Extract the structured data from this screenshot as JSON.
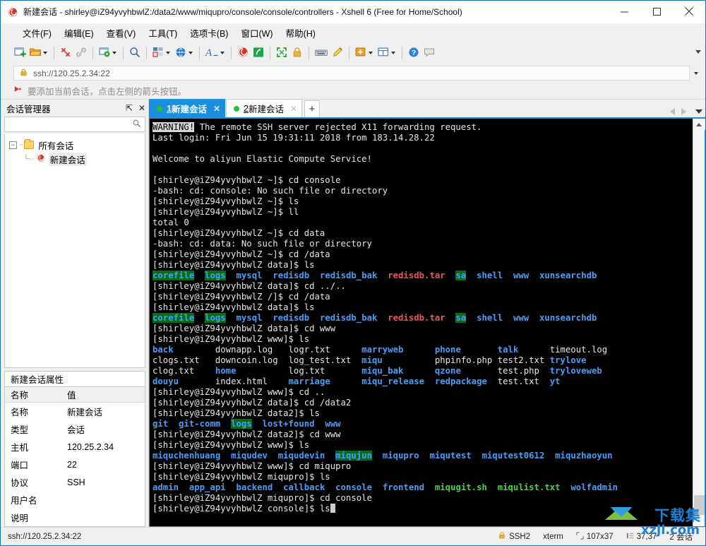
{
  "window": {
    "title": "新建会话 - shirley@iZ94yvyhbwlZ:/data2/www/miqupro/console/console/controllers - Xshell 6 (Free for Home/School)",
    "minimize": "—",
    "maximize": "▢",
    "close": "✕"
  },
  "menubar": [
    {
      "label": "文件(F)",
      "name": "menu-file"
    },
    {
      "label": "编辑(E)",
      "name": "menu-edit"
    },
    {
      "label": "查看(V)",
      "name": "menu-view"
    },
    {
      "label": "工具(T)",
      "name": "menu-tools"
    },
    {
      "label": "选项卡(B)",
      "name": "menu-tabs"
    },
    {
      "label": "窗口(W)",
      "name": "menu-window"
    },
    {
      "label": "帮助(H)",
      "name": "menu-help"
    }
  ],
  "address": {
    "value": "ssh://120.25.2.34:22",
    "lock_icon": "lock-icon",
    "dropdown_icon": "chevron-down-icon"
  },
  "hint": {
    "text": "要添加当前会话，点击左侧的箭头按钮。",
    "icon": "red-arrow-icon"
  },
  "sidebar": {
    "panel_title": "会话管理器",
    "pin_label": "⇱",
    "close_label": "✕",
    "search_icon": "search-icon",
    "tree": {
      "root_label": "所有会话",
      "child_label": "新建会话",
      "expander": "−"
    },
    "properties": {
      "title": "新建会话属性",
      "columns": [
        "名称",
        "值"
      ],
      "rows": [
        {
          "name": "名称",
          "value": "新建会话"
        },
        {
          "name": "类型",
          "value": "会话"
        },
        {
          "name": "主机",
          "value": "120.25.2.34"
        },
        {
          "name": "端口",
          "value": "22"
        },
        {
          "name": "协议",
          "value": "SSH"
        },
        {
          "name": "用户名",
          "value": ""
        },
        {
          "name": "说明",
          "value": ""
        }
      ]
    }
  },
  "tabs": {
    "items": [
      {
        "num": "1",
        "label": "新建会话",
        "active": true,
        "close": "✕"
      },
      {
        "num": "2",
        "label": "新建会话",
        "active": false,
        "close": "✕"
      }
    ],
    "add_label": "+"
  },
  "terminal": {
    "lines": [
      [
        {
          "t": "WARNING!",
          "c": "inv"
        },
        {
          "t": " The remote SSH server rejected X11 forwarding request.",
          "c": "c-white"
        }
      ],
      [
        {
          "t": "Last login: Fri Jun 15 19:31:11 2018 from 183.14.28.22",
          "c": "c-white"
        }
      ],
      [],
      [
        {
          "t": "Welcome to aliyun Elastic Compute Service!",
          "c": "c-white"
        }
      ],
      [],
      [
        {
          "t": "[shirley@iZ94yvyhbwlZ ~]$ cd console",
          "c": "c-white"
        }
      ],
      [
        {
          "t": "-bash: cd: console: No such file or directory",
          "c": "c-white"
        }
      ],
      [
        {
          "t": "[shirley@iZ94yvyhbwlZ ~]$ ls",
          "c": "c-white"
        }
      ],
      [
        {
          "t": "[shirley@iZ94yvyhbwlZ ~]$ ll",
          "c": "c-white"
        }
      ],
      [
        {
          "t": "total 0",
          "c": "c-white"
        }
      ],
      [
        {
          "t": "[shirley@iZ94yvyhbwlZ ~]$ cd data",
          "c": "c-white"
        }
      ],
      [
        {
          "t": "-bash: cd: data: No such file or directory",
          "c": "c-white"
        }
      ],
      [
        {
          "t": "[shirley@iZ94yvyhbwlZ ~]$ cd /data",
          "c": "c-white"
        }
      ],
      [
        {
          "t": "[shirley@iZ94yvyhbwlZ data]$ ls",
          "c": "c-white"
        }
      ],
      [
        {
          "t": "corefile",
          "c": "bg-green"
        },
        {
          "t": "  ",
          "c": "c-white"
        },
        {
          "t": "logs",
          "c": "bg-green"
        },
        {
          "t": "  ",
          "c": "c-white"
        },
        {
          "t": "mysql",
          "c": "c-blue"
        },
        {
          "t": "  ",
          "c": "c-white"
        },
        {
          "t": "redisdb",
          "c": "c-blue"
        },
        {
          "t": "  ",
          "c": "c-white"
        },
        {
          "t": "redisdb_bak",
          "c": "c-blue"
        },
        {
          "t": "  ",
          "c": "c-white"
        },
        {
          "t": "redisdb.tar",
          "c": "c-red"
        },
        {
          "t": "  ",
          "c": "c-white"
        },
        {
          "t": "sa",
          "c": "bg-green"
        },
        {
          "t": "  ",
          "c": "c-white"
        },
        {
          "t": "shell",
          "c": "c-blue"
        },
        {
          "t": "  ",
          "c": "c-white"
        },
        {
          "t": "www",
          "c": "c-blue"
        },
        {
          "t": "  ",
          "c": "c-white"
        },
        {
          "t": "xunsearchdb",
          "c": "c-blue"
        }
      ],
      [
        {
          "t": "[shirley@iZ94yvyhbwlZ data]$ cd ../..",
          "c": "c-white"
        }
      ],
      [
        {
          "t": "[shirley@iZ94yvyhbwlZ /]$ cd /data",
          "c": "c-white"
        }
      ],
      [
        {
          "t": "[shirley@iZ94yvyhbwlZ data]$ ls",
          "c": "c-white"
        }
      ],
      [
        {
          "t": "corefile",
          "c": "bg-green"
        },
        {
          "t": "  ",
          "c": "c-white"
        },
        {
          "t": "logs",
          "c": "bg-green"
        },
        {
          "t": "  ",
          "c": "c-white"
        },
        {
          "t": "mysql",
          "c": "c-blue"
        },
        {
          "t": "  ",
          "c": "c-white"
        },
        {
          "t": "redisdb",
          "c": "c-blue"
        },
        {
          "t": "  ",
          "c": "c-white"
        },
        {
          "t": "redisdb_bak",
          "c": "c-blue"
        },
        {
          "t": "  ",
          "c": "c-white"
        },
        {
          "t": "redisdb.tar",
          "c": "c-red"
        },
        {
          "t": "  ",
          "c": "c-white"
        },
        {
          "t": "sa",
          "c": "bg-green"
        },
        {
          "t": "  ",
          "c": "c-white"
        },
        {
          "t": "shell",
          "c": "c-blue"
        },
        {
          "t": "  ",
          "c": "c-white"
        },
        {
          "t": "www",
          "c": "c-blue"
        },
        {
          "t": "  ",
          "c": "c-white"
        },
        {
          "t": "xunsearchdb",
          "c": "c-blue"
        }
      ],
      [
        {
          "t": "[shirley@iZ94yvyhbwlZ data]$ cd www",
          "c": "c-white"
        }
      ],
      [
        {
          "t": "[shirley@iZ94yvyhbwlZ www]$ ls",
          "c": "c-white"
        }
      ],
      [
        {
          "t": "back",
          "c": "c-blue"
        },
        {
          "t": "        ",
          "c": "c-white"
        },
        {
          "t": "downapp.log",
          "c": "c-white"
        },
        {
          "t": "   ",
          "c": "c-white"
        },
        {
          "t": "logr.txt",
          "c": "c-white"
        },
        {
          "t": "      ",
          "c": "c-white"
        },
        {
          "t": "marryweb",
          "c": "c-blue"
        },
        {
          "t": "      ",
          "c": "c-white"
        },
        {
          "t": "phone",
          "c": "c-blue"
        },
        {
          "t": "       ",
          "c": "c-white"
        },
        {
          "t": "talk",
          "c": "c-blue"
        },
        {
          "t": "      ",
          "c": "c-white"
        },
        {
          "t": "timeout.log",
          "c": "c-white"
        }
      ],
      [
        {
          "t": "clogs.txt",
          "c": "c-white"
        },
        {
          "t": "   ",
          "c": "c-white"
        },
        {
          "t": "downcoin.log",
          "c": "c-white"
        },
        {
          "t": "  ",
          "c": "c-white"
        },
        {
          "t": "log_test.txt",
          "c": "c-white"
        },
        {
          "t": "  ",
          "c": "c-white"
        },
        {
          "t": "miqu",
          "c": "c-blue"
        },
        {
          "t": "          ",
          "c": "c-white"
        },
        {
          "t": "phpinfo.php",
          "c": "c-white"
        },
        {
          "t": " ",
          "c": "c-white"
        },
        {
          "t": "test2.txt",
          "c": "c-white"
        },
        {
          "t": " ",
          "c": "c-white"
        },
        {
          "t": "trylove",
          "c": "c-blue"
        }
      ],
      [
        {
          "t": "clog.txt",
          "c": "c-white"
        },
        {
          "t": "    ",
          "c": "c-white"
        },
        {
          "t": "home",
          "c": "c-blue"
        },
        {
          "t": "          ",
          "c": "c-white"
        },
        {
          "t": "log.txt",
          "c": "c-white"
        },
        {
          "t": "       ",
          "c": "c-white"
        },
        {
          "t": "miqu_bak",
          "c": "c-blue"
        },
        {
          "t": "      ",
          "c": "c-white"
        },
        {
          "t": "qzone",
          "c": "c-blue"
        },
        {
          "t": "       ",
          "c": "c-white"
        },
        {
          "t": "test.php",
          "c": "c-white"
        },
        {
          "t": "  ",
          "c": "c-white"
        },
        {
          "t": "tryloveweb",
          "c": "c-blue"
        }
      ],
      [
        {
          "t": "douyu",
          "c": "c-blue"
        },
        {
          "t": "       ",
          "c": "c-white"
        },
        {
          "t": "index.html",
          "c": "c-white"
        },
        {
          "t": "    ",
          "c": "c-white"
        },
        {
          "t": "marriage",
          "c": "c-blue"
        },
        {
          "t": "      ",
          "c": "c-white"
        },
        {
          "t": "miqu_release",
          "c": "c-blue"
        },
        {
          "t": "  ",
          "c": "c-white"
        },
        {
          "t": "redpackage",
          "c": "c-blue"
        },
        {
          "t": "  ",
          "c": "c-white"
        },
        {
          "t": "test.txt",
          "c": "c-white"
        },
        {
          "t": "  ",
          "c": "c-white"
        },
        {
          "t": "yt",
          "c": "c-blue"
        }
      ],
      [
        {
          "t": "[shirley@iZ94yvyhbwlZ www]$ cd ..",
          "c": "c-white"
        }
      ],
      [
        {
          "t": "[shirley@iZ94yvyhbwlZ data]$ cd /data2",
          "c": "c-white"
        }
      ],
      [
        {
          "t": "[shirley@iZ94yvyhbwlZ data2]$ ls",
          "c": "c-white"
        }
      ],
      [
        {
          "t": "git",
          "c": "c-blue"
        },
        {
          "t": "  ",
          "c": "c-white"
        },
        {
          "t": "git-comm",
          "c": "c-blue"
        },
        {
          "t": "  ",
          "c": "c-white"
        },
        {
          "t": "logs",
          "c": "bg-green"
        },
        {
          "t": "  ",
          "c": "c-white"
        },
        {
          "t": "lost+found",
          "c": "c-blue"
        },
        {
          "t": "  ",
          "c": "c-white"
        },
        {
          "t": "www",
          "c": "c-blue"
        }
      ],
      [
        {
          "t": "[shirley@iZ94yvyhbwlZ data2]$ cd www",
          "c": "c-white"
        }
      ],
      [
        {
          "t": "[shirley@iZ94yvyhbwlZ www]$ ls",
          "c": "c-white"
        }
      ],
      [
        {
          "t": "miquchenhuang",
          "c": "c-blue"
        },
        {
          "t": "  ",
          "c": "c-white"
        },
        {
          "t": "miqudev",
          "c": "c-blue"
        },
        {
          "t": "  ",
          "c": "c-white"
        },
        {
          "t": "miqudevin",
          "c": "c-blue"
        },
        {
          "t": "  ",
          "c": "c-white"
        },
        {
          "t": "miqujun",
          "c": "bg-green"
        },
        {
          "t": "  ",
          "c": "c-white"
        },
        {
          "t": "miqupro",
          "c": "c-blue"
        },
        {
          "t": "  ",
          "c": "c-white"
        },
        {
          "t": "miqutest",
          "c": "c-blue"
        },
        {
          "t": "  ",
          "c": "c-white"
        },
        {
          "t": "miqutest0612",
          "c": "c-blue"
        },
        {
          "t": "  ",
          "c": "c-white"
        },
        {
          "t": "miquzhaoyun",
          "c": "c-blue"
        }
      ],
      [
        {
          "t": "[shirley@iZ94yvyhbwlZ www]$ cd miqupro",
          "c": "c-white"
        }
      ],
      [
        {
          "t": "[shirley@iZ94yvyhbwlZ miqupro]$ ls",
          "c": "c-white"
        }
      ],
      [
        {
          "t": "admin",
          "c": "c-blue"
        },
        {
          "t": "  ",
          "c": "c-white"
        },
        {
          "t": "app_api",
          "c": "c-blue"
        },
        {
          "t": "  ",
          "c": "c-white"
        },
        {
          "t": "backend",
          "c": "c-blue"
        },
        {
          "t": "  ",
          "c": "c-white"
        },
        {
          "t": "callback",
          "c": "c-blue"
        },
        {
          "t": "  ",
          "c": "c-white"
        },
        {
          "t": "console",
          "c": "c-blue"
        },
        {
          "t": "  ",
          "c": "c-white"
        },
        {
          "t": "frontend",
          "c": "c-blue"
        },
        {
          "t": "  ",
          "c": "c-white"
        },
        {
          "t": "miqugit.sh",
          "c": "c-green"
        },
        {
          "t": "  ",
          "c": "c-white"
        },
        {
          "t": "miqulist.txt",
          "c": "c-green"
        },
        {
          "t": "  ",
          "c": "c-white"
        },
        {
          "t": "wolfadmin",
          "c": "c-blue"
        }
      ],
      [
        {
          "t": "[shirley@iZ94yvyhbwlZ miqupro]$ cd console",
          "c": "c-white"
        }
      ],
      [
        {
          "t": "[shirley@iZ94yvyhbwlZ console]$ ls",
          "c": "c-white"
        }
      ]
    ]
  },
  "statusbar": {
    "url": "ssh://120.25.2.34:22",
    "protocol": "SSH2",
    "term_type": "xterm",
    "size": "107x37",
    "cursor": "37,37",
    "sessions": "2 会话",
    "lock_icon": "lock-icon",
    "size_icon": "terminal-size-icon",
    "cursor_icon": "cursor-pos-icon"
  },
  "watermark": {
    "cn": "下载集",
    "en": "xzji.com"
  },
  "toolbar": {
    "items": [
      {
        "name": "new-session-button",
        "icon": "new-session-icon"
      },
      {
        "name": "open-session-button",
        "icon": "folder-open-icon",
        "caret": true
      },
      {
        "name": "disconnect-button",
        "icon": "disconnect-icon"
      },
      {
        "name": "reconnect-button",
        "icon": "link-icon"
      },
      {
        "name": "session-properties-button",
        "icon": "properties-gear-icon",
        "caret": true
      },
      {
        "name": "find-button",
        "icon": "search-icon"
      },
      {
        "name": "layout-button",
        "icon": "layout-icon",
        "caret": true
      },
      {
        "name": "web-button",
        "icon": "globe-icon",
        "caret": true
      },
      {
        "name": "font-button",
        "icon": "font-icon",
        "caret": true
      },
      {
        "name": "xshell-button",
        "icon": "xshell-icon"
      },
      {
        "name": "xftp-button",
        "icon": "xftp-icon"
      },
      {
        "name": "fullscreen-button",
        "icon": "fullscreen-icon"
      },
      {
        "name": "lock-button",
        "icon": "lock-icon"
      },
      {
        "name": "keyboard-button",
        "icon": "keyboard-icon"
      },
      {
        "name": "highlight-button",
        "icon": "highlight-pen-icon"
      },
      {
        "name": "add-tool-button",
        "icon": "add-box-icon",
        "caret": true
      },
      {
        "name": "split-view-button",
        "icon": "split-view-icon",
        "caret": true
      },
      {
        "name": "help-button",
        "icon": "help-icon"
      },
      {
        "name": "chat-button",
        "icon": "chat-icon"
      }
    ]
  }
}
